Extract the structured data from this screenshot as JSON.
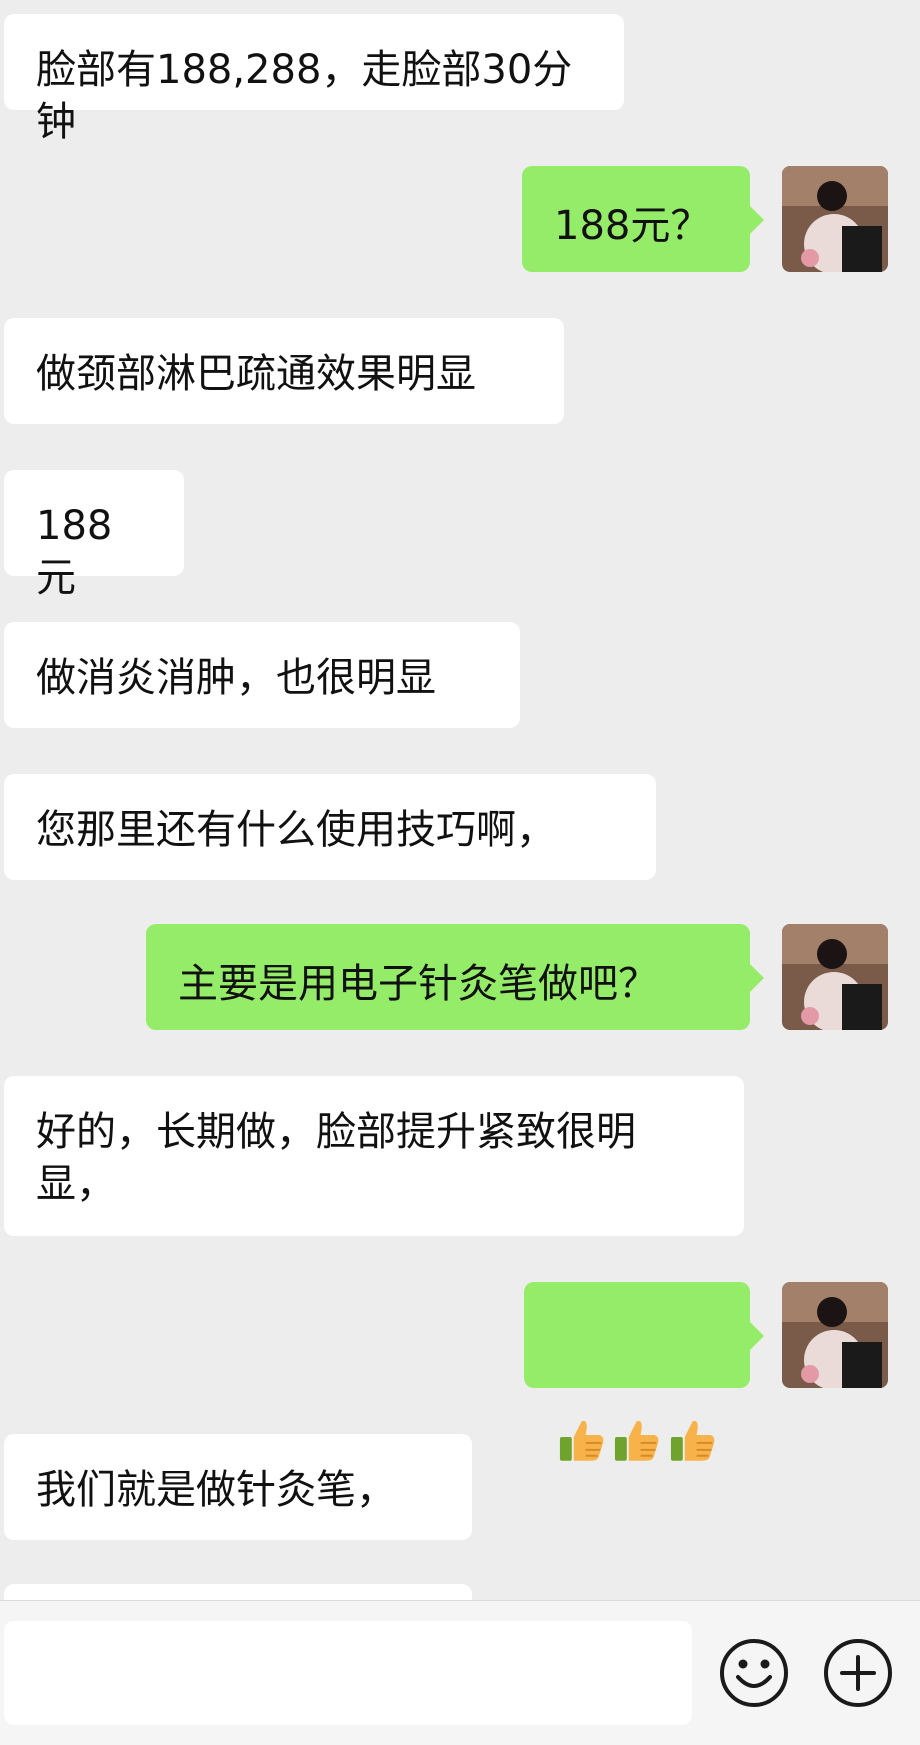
{
  "messages": [
    {
      "side": "in",
      "text": "脸部有188,288，走脸部30分钟"
    },
    {
      "side": "out",
      "text": "188元？"
    },
    {
      "side": "in",
      "text": "做颈部淋巴疏通效果明显"
    },
    {
      "side": "in",
      "text": "188元"
    },
    {
      "side": "in",
      "text": "做消炎消肿，也很明显"
    },
    {
      "side": "in",
      "text": "您那里还有什么使用技巧啊，"
    },
    {
      "side": "out",
      "text": "主要是用电子针灸笔做吧？"
    },
    {
      "side": "in",
      "text": "好的，长期做，脸部提升紧致很明\n显，"
    },
    {
      "side": "out",
      "text": "",
      "emoji": [
        "thumbs-up-icon",
        "thumbs-up-icon",
        "thumbs-up-icon"
      ]
    },
    {
      "side": "in",
      "text": "我们就是做针灸笔，"
    }
  ],
  "input": {
    "value": "",
    "placeholder": ""
  },
  "icons": {
    "emoji_button": "smiley-face-icon",
    "more_button": "plus-circle-icon"
  },
  "colors": {
    "background": "#ededed",
    "incoming_bubble": "#ffffff",
    "outgoing_bubble": "#95ec69"
  }
}
